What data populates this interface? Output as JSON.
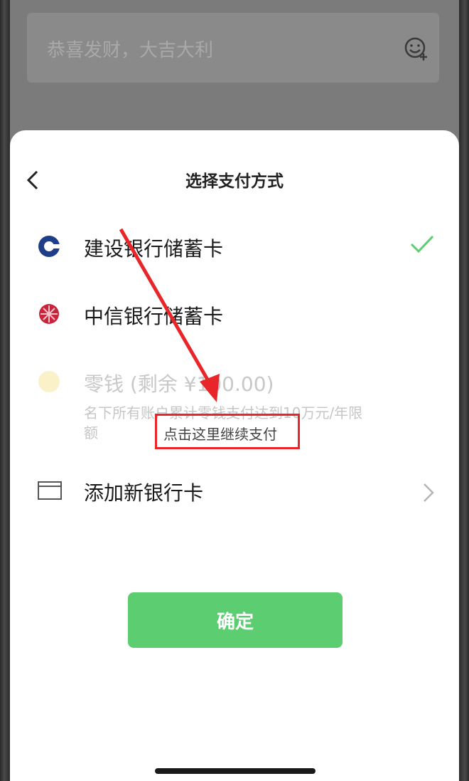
{
  "background": {
    "greeting": "恭喜发财，大吉大利"
  },
  "sheet": {
    "title": "选择支付方式",
    "options": [
      {
        "label": "建设银行储蓄卡",
        "icon": "ccb-bank-icon",
        "selected": true
      },
      {
        "label": "中信银行储蓄卡",
        "icon": "citic-bank-icon",
        "selected": false
      },
      {
        "label": "零钱 (剩余 ¥100.00)",
        "icon": "wallet-change-icon",
        "disabled": true
      },
      {
        "label": "添加新银行卡",
        "icon": "card-icon"
      }
    ],
    "balance_note": "名下所有账户累计零钱支付达到10万元/年限额",
    "continue_link": "点击这里继续支付",
    "confirm_label": "确定"
  },
  "colors": {
    "accent_green": "#5ccd70",
    "annotation_red": "#e8262a"
  }
}
